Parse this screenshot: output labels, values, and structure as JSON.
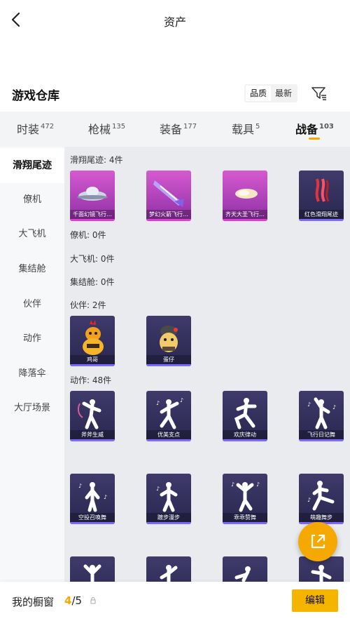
{
  "header": {
    "title": "资产"
  },
  "warehouse": {
    "title": "游戏仓库",
    "sort_options": [
      "品质",
      "最新"
    ]
  },
  "category_tabs": [
    {
      "label": "时装",
      "count": "472"
    },
    {
      "label": "枪械",
      "count": "135"
    },
    {
      "label": "装备",
      "count": "177"
    },
    {
      "label": "载具",
      "count": "5"
    },
    {
      "label": "战备",
      "count": "103"
    }
  ],
  "sidebar": {
    "items": [
      "滑翔尾迹",
      "僚机",
      "大飞机",
      "集结舱",
      "伙伴",
      "动作",
      "降落伞",
      "大厅场景"
    ]
  },
  "sections": {
    "glide": {
      "label": "滑翔尾迹: 4件",
      "items": [
        "千面幻镜飞行…",
        "梦幻火箭飞行…",
        "齐天大圣飞行…",
        "红色滑翔尾迹"
      ]
    },
    "wingman": {
      "label": "僚机: 0件"
    },
    "plane": {
      "label": "大飞机: 0件"
    },
    "pod": {
      "label": "集结舱: 0件"
    },
    "partner": {
      "label": "伙伴: 2件",
      "items": [
        "鸡哥",
        "蛋仔"
      ]
    },
    "emote": {
      "label": "动作: 48件",
      "items": [
        "斧斧生威",
        "优美支点",
        "欢庆律动",
        "飞行日记舞",
        "空投召唤舞",
        "踱步漫步",
        "乖乖赞舞",
        "萌趣舞步"
      ]
    }
  },
  "bottom": {
    "label": "我的橱窗",
    "current": "4",
    "total": "/5",
    "edit_label": "编辑"
  },
  "colors": {
    "accent": "#f5a900",
    "purple_quality": "#d65ad0",
    "dark_quality": "#2a2750"
  }
}
